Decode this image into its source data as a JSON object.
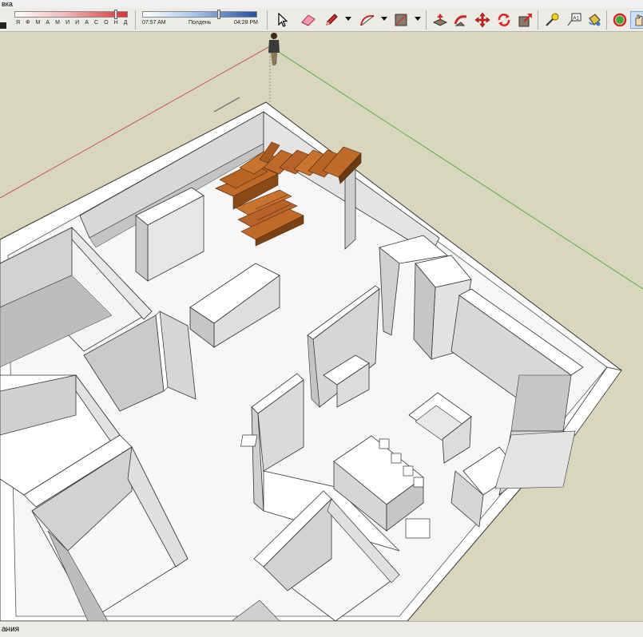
{
  "window": {
    "title": "вка"
  },
  "toolbar": {
    "months": [
      "Я",
      "Ф",
      "М",
      "А",
      "М",
      "И",
      "И",
      "А",
      "С",
      "О",
      "Н",
      "Д"
    ],
    "time_start": "07:57 AM",
    "time_mid": "Полдень",
    "time_end": "04:28 PM",
    "icons": [
      "select-icon",
      "eraser-icon",
      "pencil-icon",
      "arc-icon",
      "rectangle-icon",
      "push-pull-icon",
      "follow-me-icon",
      "move-icon",
      "rotate-icon",
      "scale-icon",
      "tape-measure-icon",
      "text-icon",
      "paint-bucket-icon",
      "orbit-icon",
      "pan-icon"
    ]
  },
  "statusbar": {
    "text": "ания"
  },
  "colors": {
    "ground": "#d8d6bd",
    "wall_top": "#ffffff",
    "wall_side": "#d4d4d4",
    "stair_wood": "#b35a1c",
    "red_axis": "#c83a3a",
    "green_axis": "#3aa83a"
  }
}
